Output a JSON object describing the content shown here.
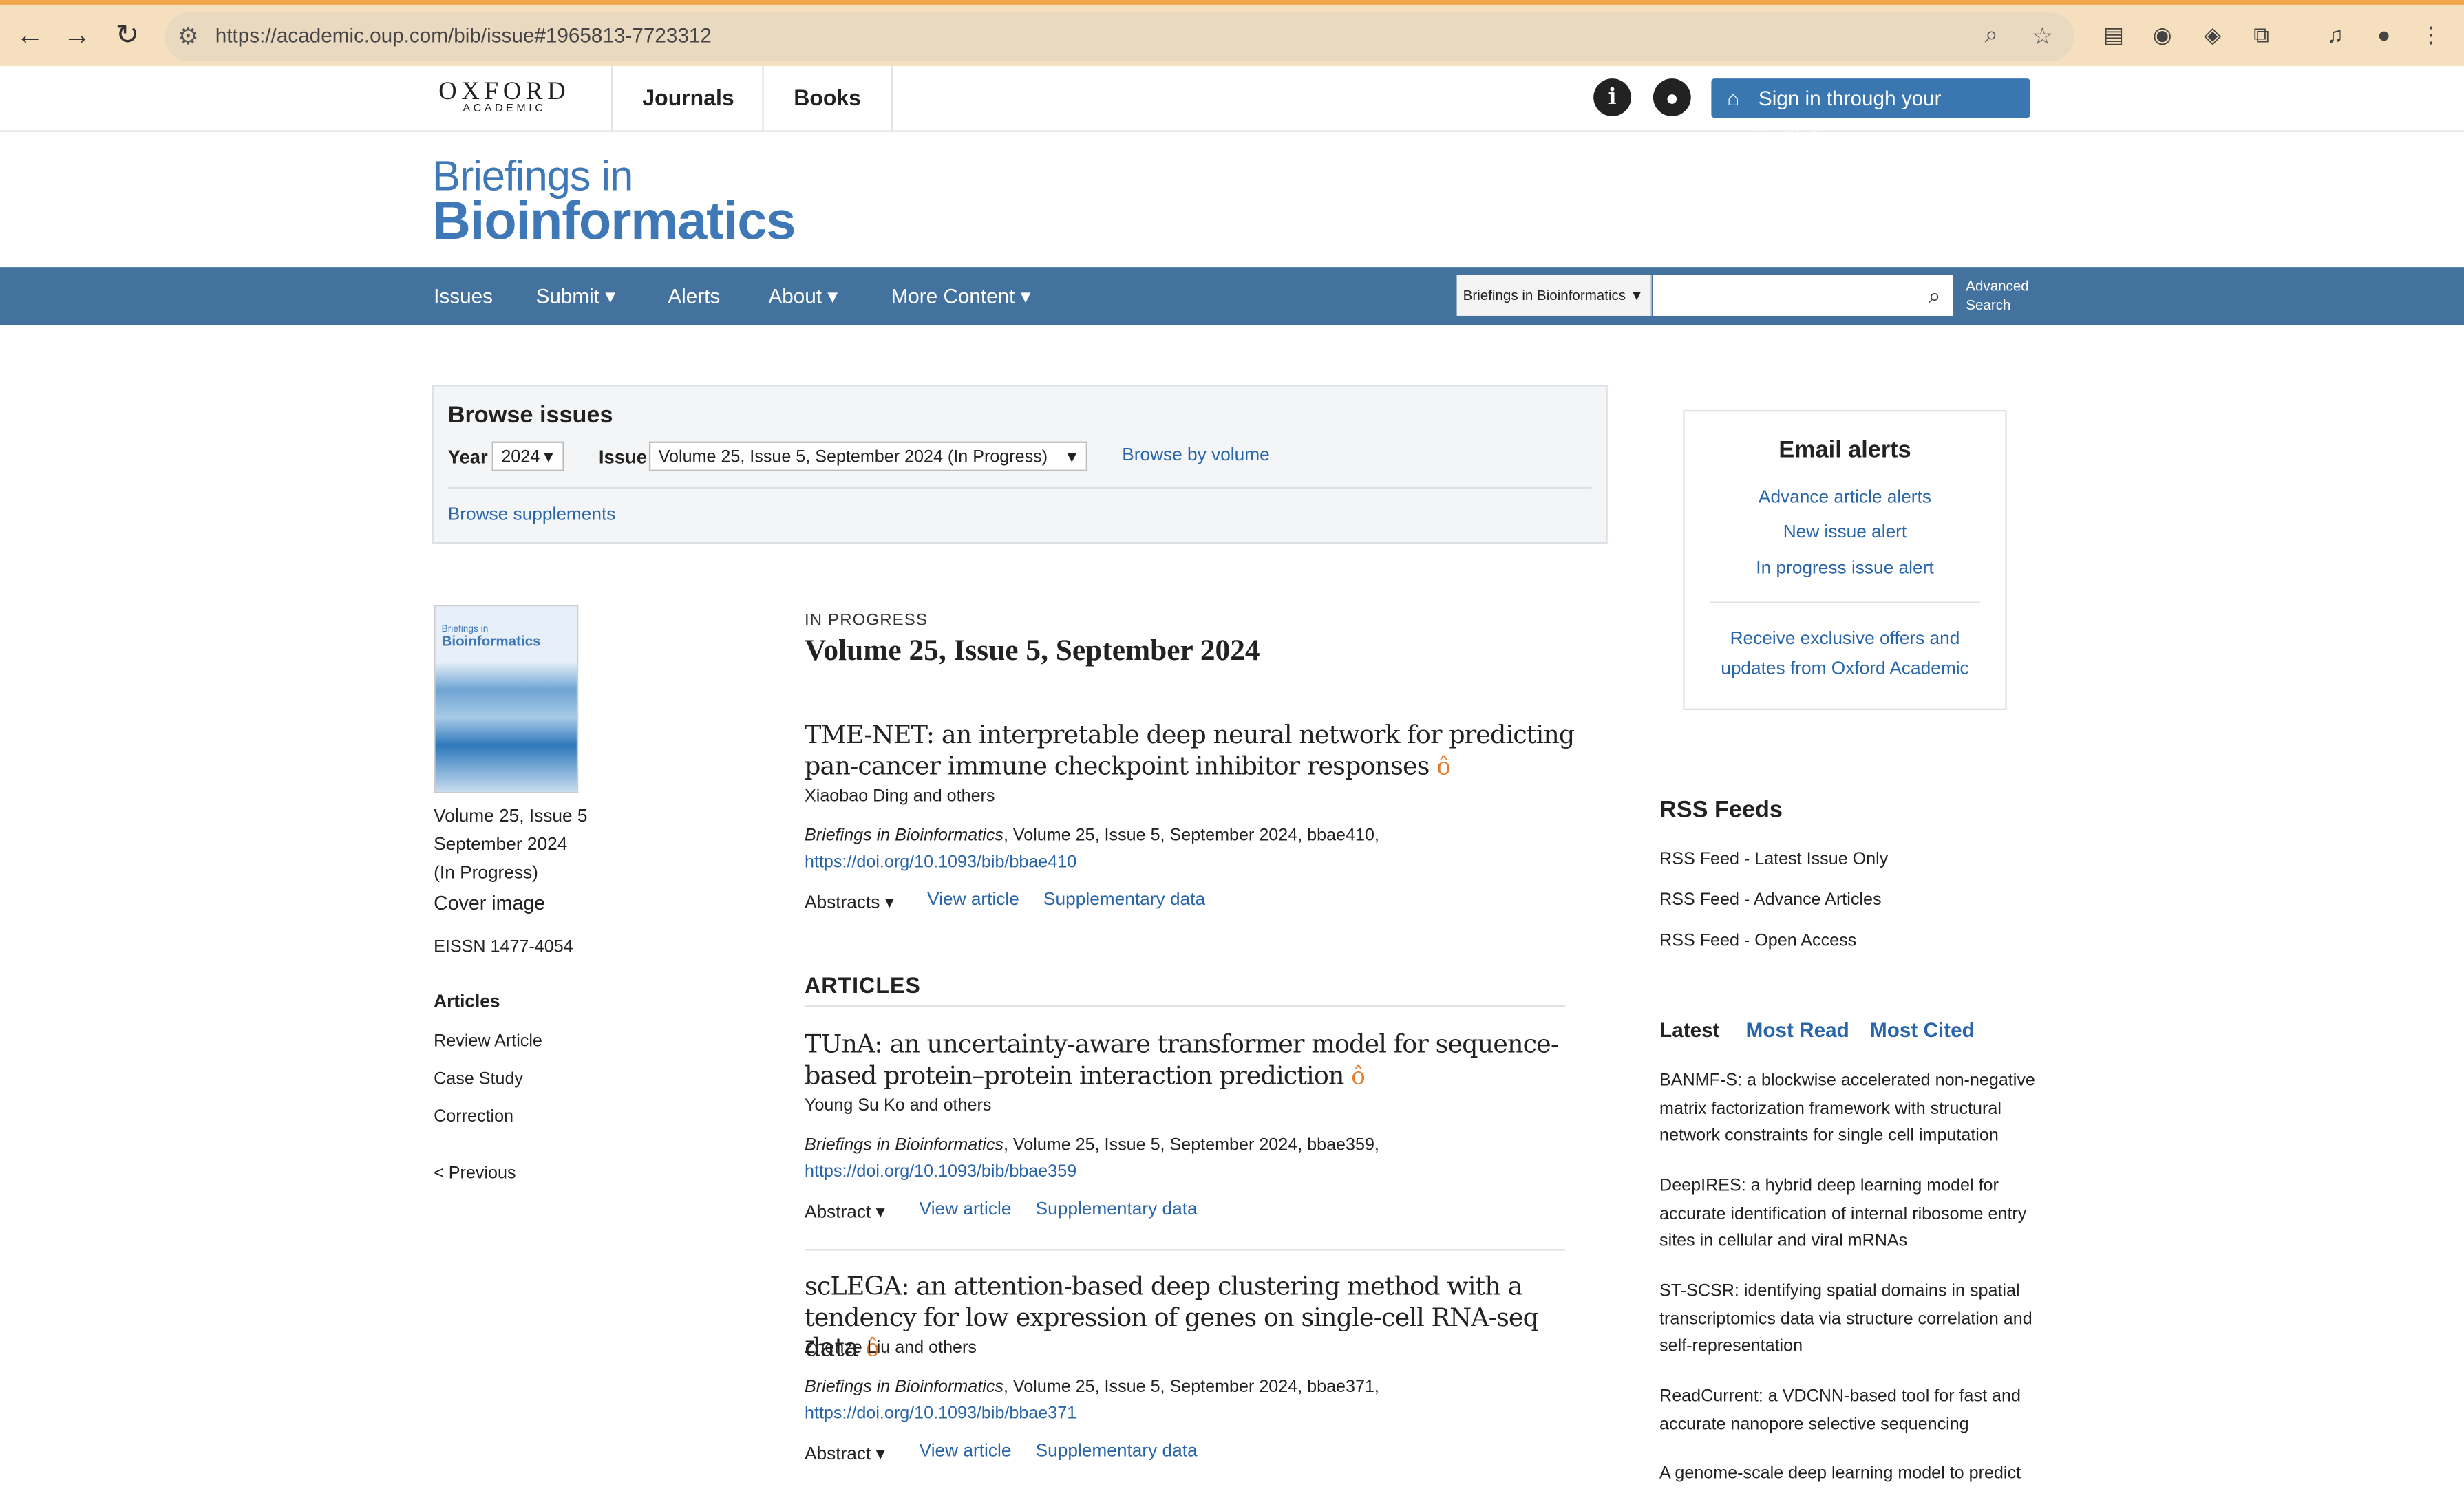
{
  "browser": {
    "url": "https://academic.oup.com/bib/issue#1965813-7723312"
  },
  "topnav": {
    "logo_main": "OXFORD",
    "logo_sub": "ACADEMIC",
    "tabs": [
      "Journals",
      "Books"
    ],
    "sign_in": "Sign in through your institution"
  },
  "journal": {
    "line1": "Briefings in",
    "line2": "Bioinformatics"
  },
  "bluenav": {
    "items": [
      "Issues",
      "Submit ▾",
      "Alerts",
      "About ▾",
      "More Content ▾"
    ],
    "search_scope": "Briefings in Bioinformatics",
    "advanced_line1": "Advanced",
    "advanced_line2": "Search"
  },
  "browse": {
    "title": "Browse issues",
    "year_label": "Year",
    "year_value": "2024",
    "issue_label": "Issue",
    "issue_value": "Volume 25, Issue 5, September 2024 (In Progress)",
    "browse_by_volume": "Browse by volume",
    "browse_supplements": "Browse supplements"
  },
  "sidebar": {
    "cover_title_small": "Briefings in",
    "cover_title_big": "Bioinformatics",
    "issue_line1": "Volume 25, Issue 5",
    "issue_line2": "September 2024",
    "issue_line3": "(In Progress)",
    "cover_image": "Cover image",
    "eissn": "EISSN 1477-4054",
    "articles_heading": "Articles",
    "sections": [
      "Review Article",
      "Case Study",
      "Correction"
    ],
    "previous": "< Previous"
  },
  "main": {
    "status": "IN PROGRESS",
    "volume_title": "Volume 25, Issue 5, September 2024",
    "featured": {
      "title": "TME-NET: an interpretable deep neural network for predicting pan-cancer immune checkpoint inhibitor responses",
      "authors": "Xiaobao Ding and others",
      "journal": "Briefings in Bioinformatics",
      "citation": ", Volume 25, Issue 5, September 2024, bbae410,",
      "doi": "https://doi.org/10.1093/bib/bbae410",
      "abstract_label": "Abstracts ▾",
      "view_article": "View article",
      "supplementary": "Supplementary data"
    },
    "articles_heading": "ARTICLES",
    "articles": [
      {
        "title": "TUnA: an uncertainty-aware transformer model for sequence-based protein–protein interaction prediction",
        "authors": "Young Su Ko and others",
        "journal": "Briefings in Bioinformatics",
        "citation": ", Volume 25, Issue 5, September 2024, bbae359,",
        "doi": "https://doi.org/10.1093/bib/bbae359",
        "abstract_label": "Abstract ▾",
        "view_article": "View article",
        "supplementary": "Supplementary data"
      },
      {
        "title": "scLEGA: an attention-based deep clustering method with a tendency for low expression of genes on single-cell RNA-seq data",
        "authors": "Zhenze Liu and others",
        "journal": "Briefings in Bioinformatics",
        "citation": ", Volume 25, Issue 5, September 2024, bbae371,",
        "doi": "https://doi.org/10.1093/bib/bbae371",
        "abstract_label": "Abstract ▾",
        "view_article": "View article",
        "supplementary": "Supplementary data"
      }
    ]
  },
  "email_alerts": {
    "title": "Email alerts",
    "links": [
      "Advance article alerts",
      "New issue alert",
      "In progress issue alert"
    ],
    "offers_line1": "Receive exclusive offers and",
    "offers_line2": "updates from Oxford Academic"
  },
  "rss": {
    "title": "RSS Feeds",
    "items": [
      "RSS Feed - Latest Issue Only",
      "RSS Feed - Advance Articles",
      "RSS Feed - Open Access"
    ]
  },
  "tabs": {
    "labels": [
      "Latest",
      "Most Read",
      "Most Cited"
    ],
    "items": [
      "BANMF-S: a blockwise accelerated non-negative matrix factorization framework with structural network constraints for single cell imputation",
      "DeepIRES: a hybrid deep learning model for accurate identification of internal ribosome entry sites in cellular and viral mRNAs",
      "ST-SCSR: identifying spatial domains in spatial transcriptomics data via structure correlation and self-representation",
      "ReadCurrent: a VDCNN-based tool for fast and accurate nanopore selective sequencing",
      "A genome-scale deep learning model to predict"
    ]
  },
  "colors": {
    "brand_blue": "#3f78b6",
    "nav_blue": "#44729f",
    "link_blue": "#2965a9",
    "open_access_orange": "#e47c2b",
    "browser_bar": "#f6dfbe"
  }
}
